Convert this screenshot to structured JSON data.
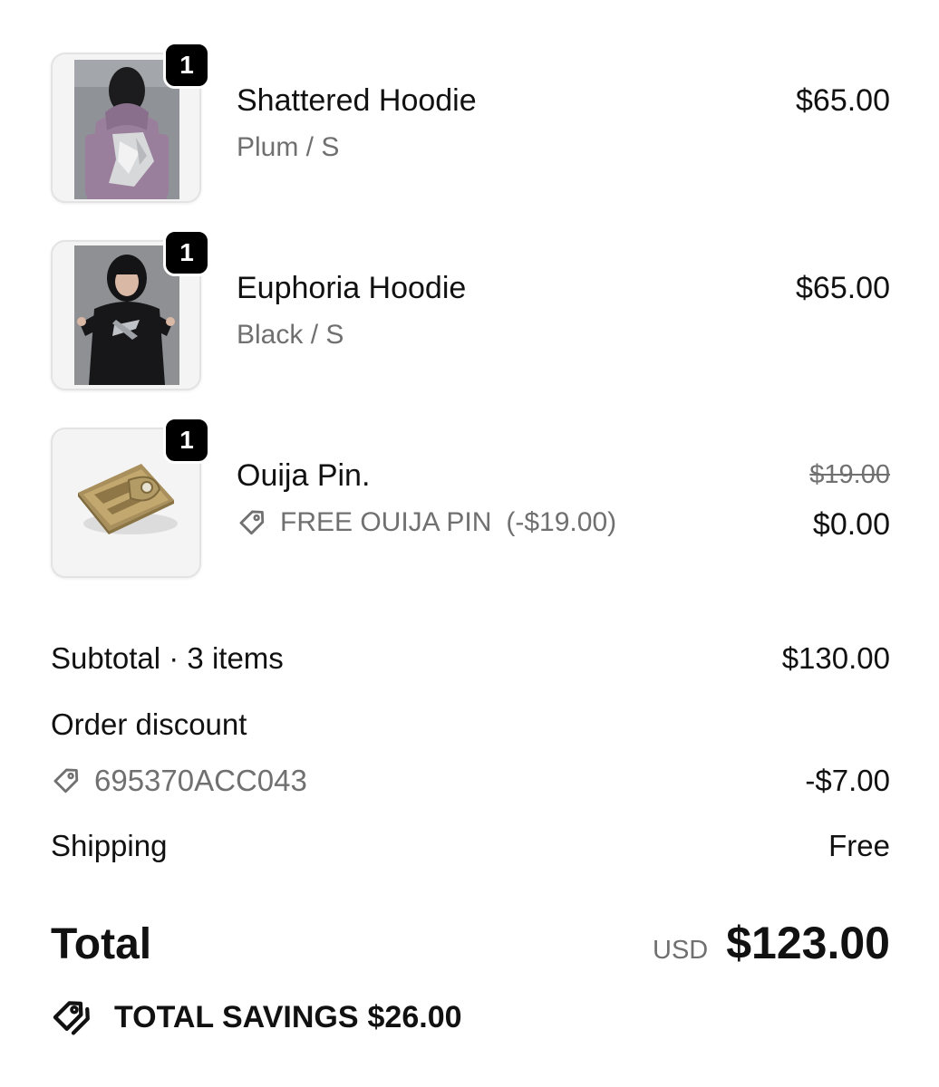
{
  "items": [
    {
      "quantity": "1",
      "name": "Shattered Hoodie",
      "variant": "Plum / S",
      "price": "$65.00"
    },
    {
      "quantity": "1",
      "name": "Euphoria Hoodie",
      "variant": "Black / S",
      "price": "$65.00"
    },
    {
      "quantity": "1",
      "name": "Ouija Pin.",
      "discount_code": "FREE OUIJA PIN",
      "discount_amount": "(-$19.00)",
      "original_price": "$19.00",
      "price": "$0.00"
    }
  ],
  "summary": {
    "subtotal_label": "Subtotal · 3 items",
    "subtotal_value": "$130.00",
    "order_discount_label": "Order discount",
    "discount_code": "695370ACC043",
    "discount_value": "-$7.00",
    "shipping_label": "Shipping",
    "shipping_value": "Free"
  },
  "total": {
    "label": "Total",
    "currency": "USD",
    "value": "$123.00"
  },
  "savings": {
    "label": "TOTAL SAVINGS",
    "value": "$26.00"
  },
  "icons": {
    "discount": "tag-icon",
    "savings": "double-tag-icon"
  },
  "colors": {
    "text": "#111111",
    "muted": "#707070",
    "badge": "#000000",
    "thumb_border": "#e3e3e3"
  }
}
